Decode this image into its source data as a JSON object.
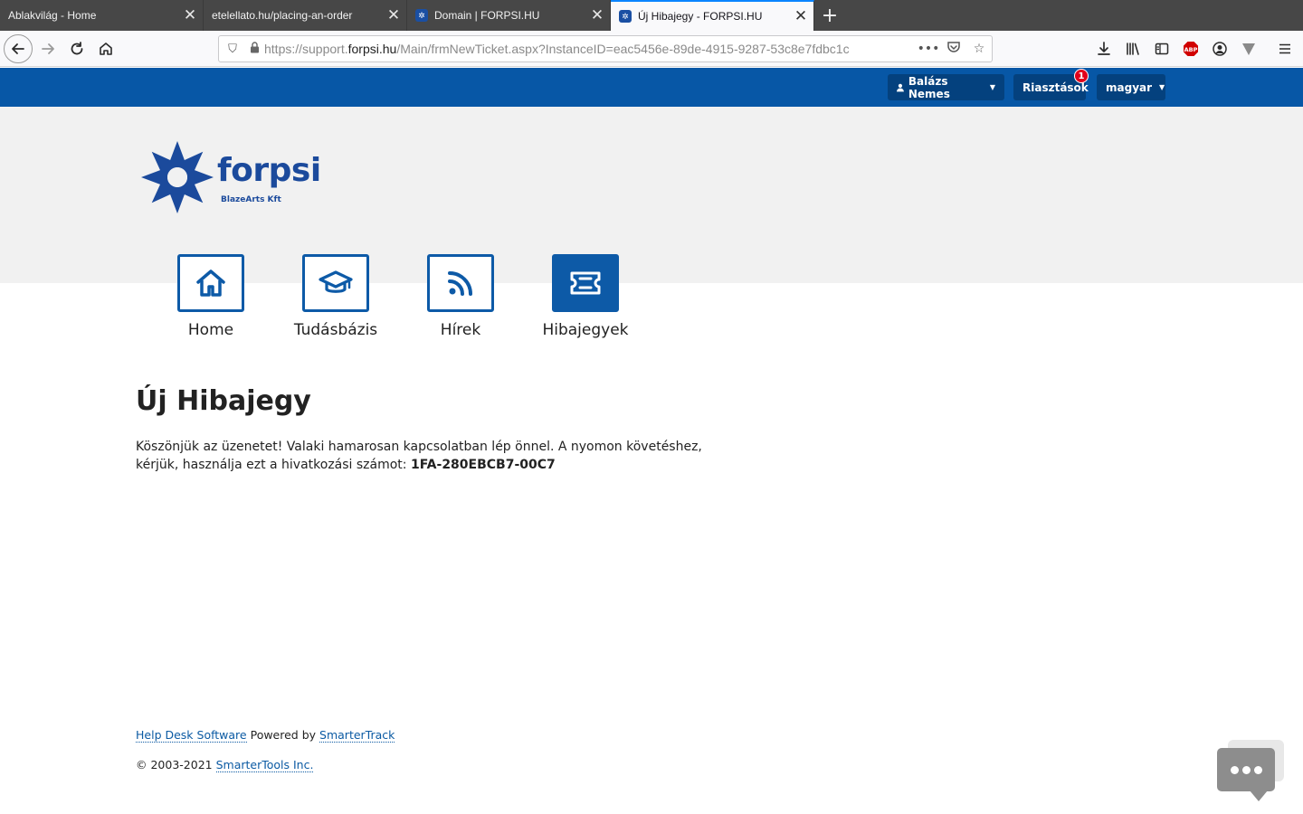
{
  "browser": {
    "tabs": [
      {
        "title": "Ablakvilág - Home",
        "favicon": "none",
        "active": false
      },
      {
        "title": "etelellato.hu/placing-an-order",
        "favicon": "none",
        "active": false
      },
      {
        "title": "Domain | FORPSI.HU",
        "favicon": "forpsi-favicon",
        "active": false
      },
      {
        "title": "Új Hibajegy - FORPSI.HU",
        "favicon": "forpsi-favicon",
        "active": true
      }
    ],
    "url": {
      "prefix": "https://support.",
      "domain": "forpsi.hu",
      "path": "/Main/frmNewTicket.aspx?InstanceID=eac5456e-89de-4915-9287-53c8e7fdbc1c"
    },
    "accent": "#0a84ff"
  },
  "header": {
    "user_label": "Balázs Nemes",
    "alerts_label": "Riasztások",
    "alerts_count": "1",
    "language_label": "magyar",
    "bar_color": "#0757a6",
    "button_color": "#04417e"
  },
  "logo": {
    "brand": "forpsi",
    "subtitle": "BlazeArts Kft"
  },
  "nav": [
    {
      "label": "Home",
      "icon": "home-icon",
      "selected": false
    },
    {
      "label": "Tudásbázis",
      "icon": "graduation-cap-icon",
      "selected": false
    },
    {
      "label": "Hírek",
      "icon": "rss-icon",
      "selected": false
    },
    {
      "label": "Hibajegyek",
      "icon": "ticket-icon",
      "selected": true
    }
  ],
  "main": {
    "title": "Új Hibajegy",
    "message_line1": "Köszönjük az üzenetet! Valaki hamarosan kapcsolatban lép önnel. A nyomon követéshez,",
    "message_line2_prefix": "kérjük, használja ezt a hivatkozási számot: ",
    "reference": "1FA-280EBCB7-00C7"
  },
  "footer": {
    "helpdesk_link": "Help Desk Software",
    "powered_by": " Powered by ",
    "smartertrack_link": "SmarterTrack",
    "copyright": "© 2003-2021 ",
    "smartertools_link": "SmarterTools Inc."
  },
  "chat_widget": {
    "icon": "chat-bubble-icon"
  }
}
